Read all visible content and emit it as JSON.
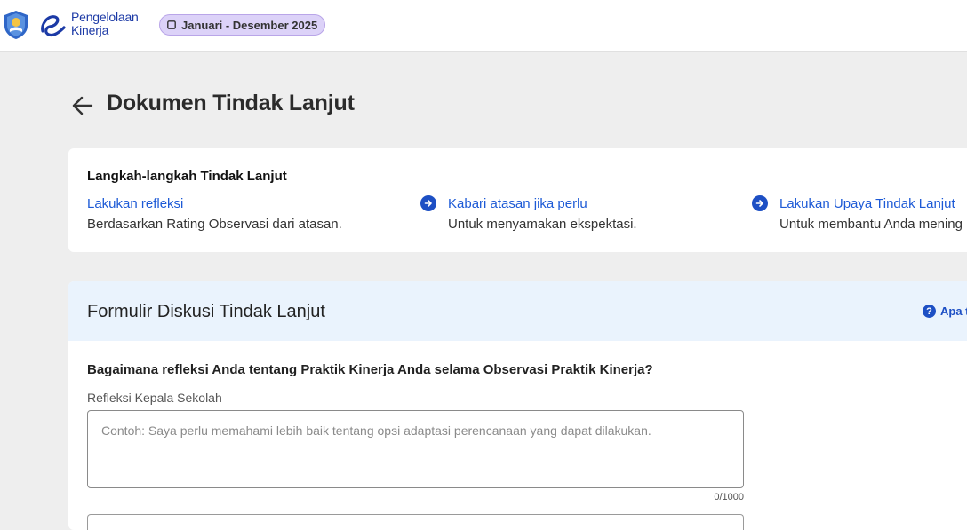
{
  "header": {
    "app_name_line1": "Pengelolaan",
    "app_name_line2": "Kinerja",
    "period": "Januari - Desember 2025"
  },
  "page": {
    "title": "Dokumen Tindak Lanjut"
  },
  "steps": {
    "heading": "Langkah-langkah Tindak Lanjut",
    "items": [
      {
        "title": "Lakukan refleksi",
        "desc": "Berdasarkan Rating Observasi dari atasan."
      },
      {
        "title": "Kabari atasan jika perlu",
        "desc": "Untuk menyamakan ekspektasi."
      },
      {
        "title": "Lakukan Upaya Tindak Lanjut",
        "desc": "Untuk membantu Anda mening"
      }
    ]
  },
  "form": {
    "title": "Formulir Diskusi Tindak Lanjut",
    "help_label": "Apa t",
    "question": "Bagaimana refleksi Anda tentang Praktik Kinerja Anda selama Observasi Praktik Kinerja?",
    "field_label": "Refleksi Kepala Sekolah",
    "placeholder": "Contoh: Saya perlu memahami lebih baik tentang opsi adaptasi perencanaan yang dapat dilakukan.",
    "value": "",
    "counter": "0/1000"
  },
  "icons": {
    "back": "arrow-left-icon",
    "step_arrow": "arrow-right-circle-icon",
    "help": "question-circle-icon",
    "calendar": "calendar-icon"
  },
  "colors": {
    "accent": "#1d4fc4",
    "link": "#1d5ad6",
    "badge_bg": "#dcd2f8",
    "form_header_bg": "#eaf3fd",
    "page_bg": "#eeeeee"
  }
}
